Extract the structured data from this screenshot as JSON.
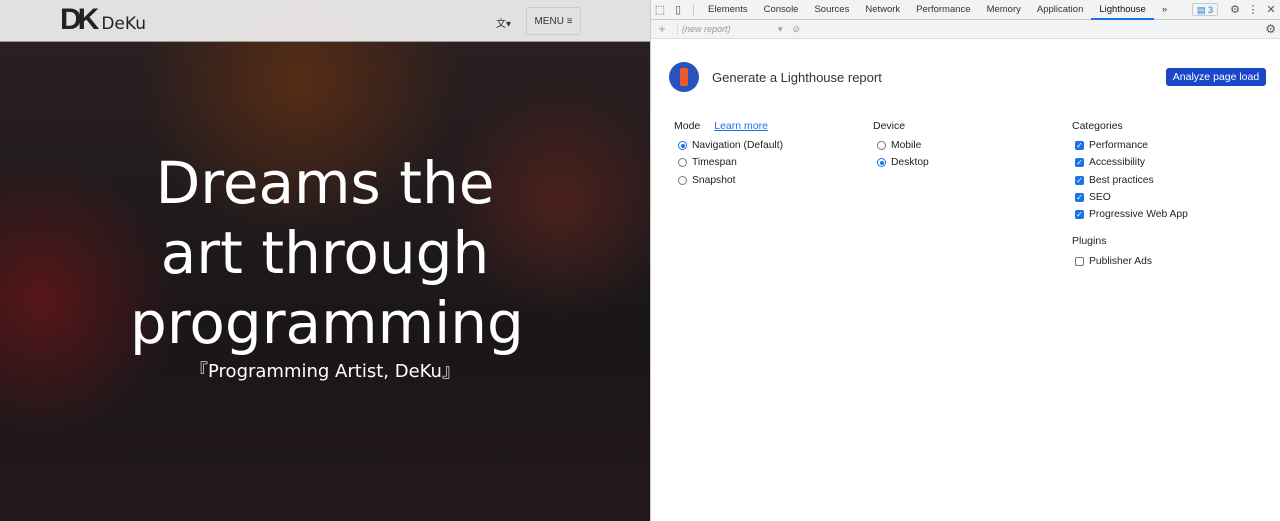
{
  "site": {
    "logo_mark": "DK",
    "logo_name": "DeKu",
    "lang_icon": "translate-icon",
    "menu_label": "MENU ≡",
    "hero_title": "Dreams the art through programming",
    "hero_subtitle": "『Programming Artist, DeKu』"
  },
  "devtools": {
    "tabs": [
      "Elements",
      "Console",
      "Sources",
      "Network",
      "Performance",
      "Memory",
      "Application",
      "Lighthouse"
    ],
    "active_tab": "Lighthouse",
    "more": "»",
    "issues_count": "3",
    "report_select": "(new report)",
    "title": "Generate a Lighthouse report",
    "analyze_label": "Analyze page load",
    "mode": {
      "label": "Mode",
      "learn_more": "Learn more",
      "options": [
        {
          "label": "Navigation (Default)",
          "on": true
        },
        {
          "label": "Timespan",
          "on": false
        },
        {
          "label": "Snapshot",
          "on": false
        }
      ]
    },
    "device": {
      "label": "Device",
      "options": [
        {
          "label": "Mobile",
          "on": false
        },
        {
          "label": "Desktop",
          "on": true
        }
      ]
    },
    "categories": {
      "label": "Categories",
      "options": [
        {
          "label": "Performance",
          "on": true
        },
        {
          "label": "Accessibility",
          "on": true
        },
        {
          "label": "Best practices",
          "on": true
        },
        {
          "label": "SEO",
          "on": true
        },
        {
          "label": "Progressive Web App",
          "on": true
        }
      ]
    },
    "plugins": {
      "label": "Plugins",
      "options": [
        {
          "label": "Publisher Ads",
          "on": false
        }
      ]
    },
    "accent": "#1a73e8"
  }
}
